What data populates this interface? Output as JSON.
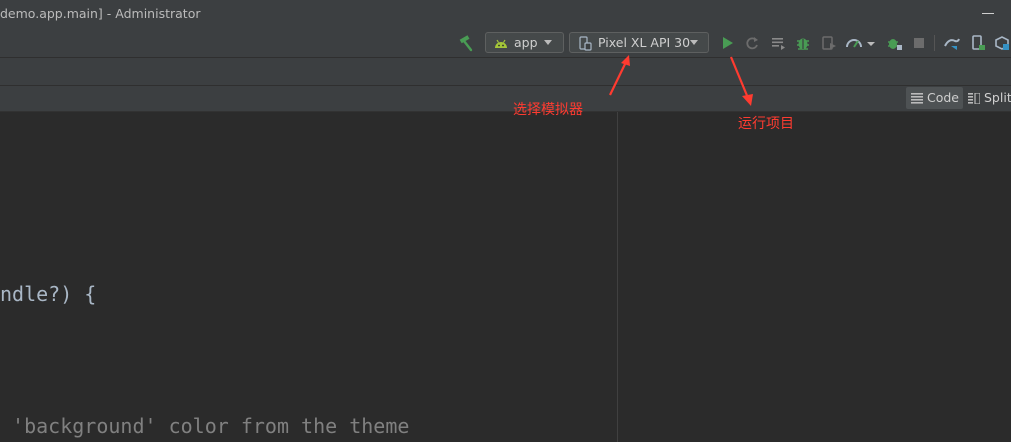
{
  "window": {
    "title": "demo.app.main] - Administrator",
    "minimize_glyph": "minimize"
  },
  "toolbar": {
    "hammer_icon": "hammer-icon",
    "run_config": {
      "label": "app",
      "icon": "android-icon"
    },
    "device": {
      "label": "Pixel XL API 30",
      "icon": "phone-icon"
    },
    "icons": [
      "run-icon",
      "rerun-icon",
      "apply-changes-icon",
      "debug-icon",
      "attach-debugger-icon",
      "profile-icon",
      "coverage-icon",
      "stop-icon",
      "gradle-sync-icon",
      "device-manager-icon",
      "sdk-manager-icon"
    ],
    "colors": {
      "run": "#499c54",
      "debug": "#499c54",
      "disabled": "#6c6c6c"
    }
  },
  "view_modes": {
    "code": "Code",
    "split": "Split"
  },
  "editor": {
    "lines": [
      {
        "text": "ndle?) {",
        "kind": "code"
      },
      {
        "text": " 'background' color from the theme",
        "kind": "comment"
      }
    ]
  },
  "annotations": {
    "select_emulator": "选择模拟器",
    "run_project": "运行项目",
    "color": "#ff3b30"
  }
}
